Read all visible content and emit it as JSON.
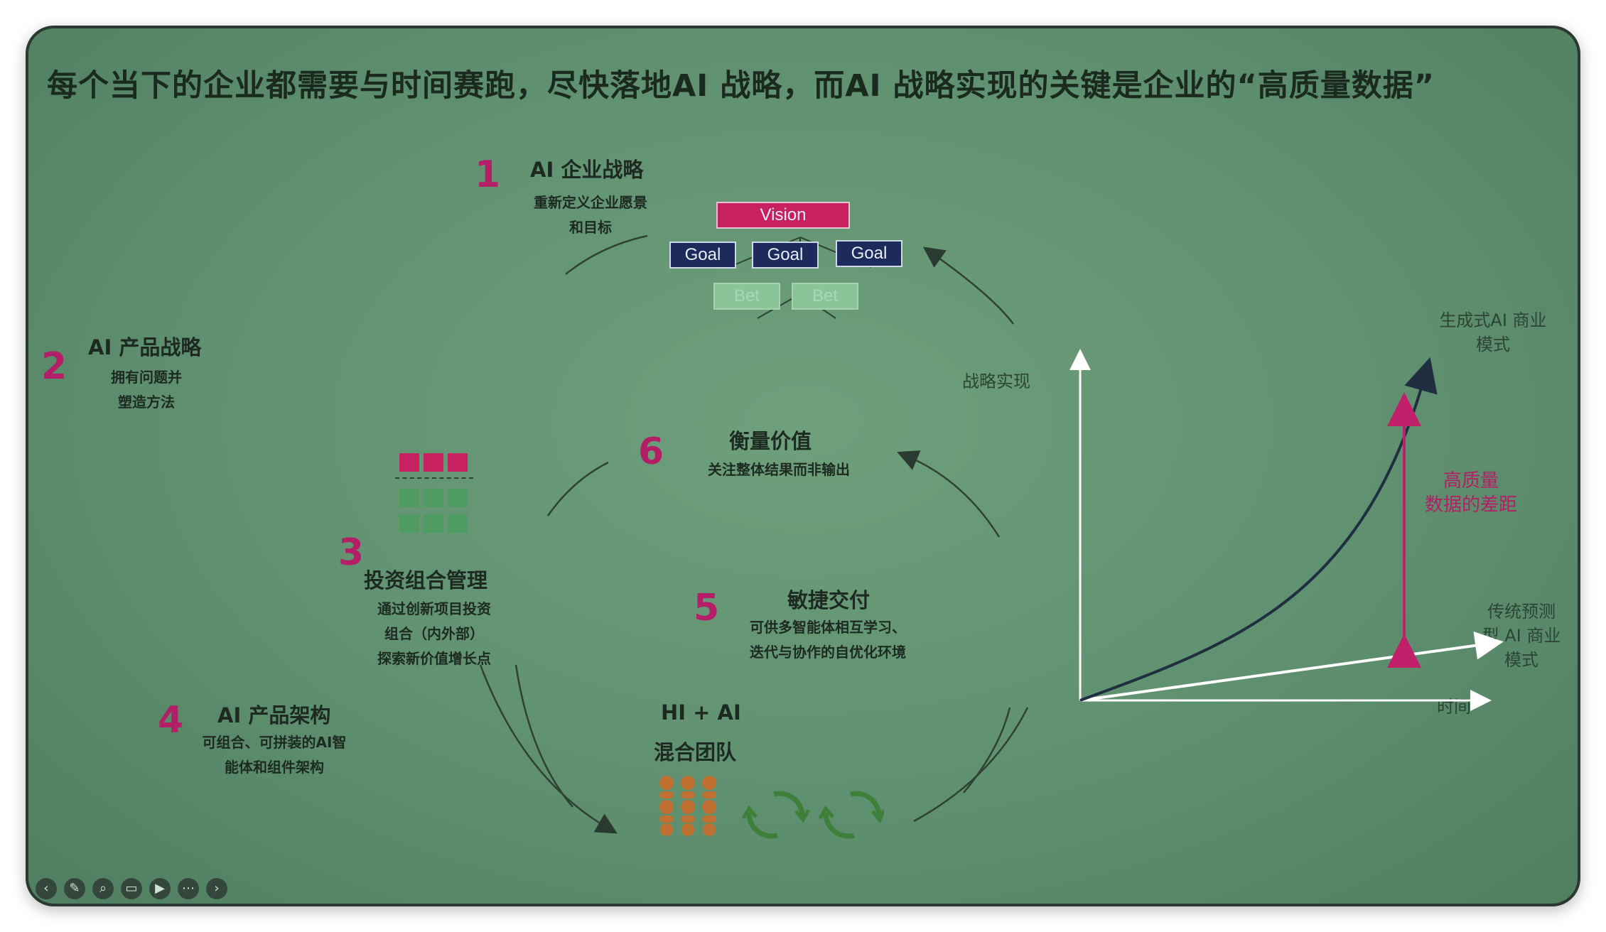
{
  "slide": {
    "title": "每个当下的企业都需要与时间赛跑，尽快落地AI 战略，而AI 战略实现的关键是企业的“高质量数据”"
  },
  "steps": [
    {
      "number": "1",
      "title": "AI 企业战略",
      "desc": [
        "重新定义企业愿景",
        "和目标"
      ]
    },
    {
      "number": "2",
      "title": "AI 产品战略",
      "desc": [
        "拥有问题并",
        "塑造方法"
      ]
    },
    {
      "number": "3",
      "title": "投资组合管理",
      "desc": [
        "通过创新项目投资",
        "组合（内外部）",
        "探索新价值增长点"
      ]
    },
    {
      "number": "4",
      "title": "AI 产品架构",
      "desc": [
        "可组合、可拼装的AI智",
        "能体和组件架构"
      ]
    },
    {
      "number": "5",
      "title": "敏捷交付",
      "desc": [
        "可供多智能体相互学习、",
        "迭代与协作的自优化环境"
      ]
    },
    {
      "number": "6",
      "title": "衡量价值",
      "desc": [
        "关注整体结果而非输出"
      ]
    }
  ],
  "hierarchy": {
    "vision": "Vision",
    "goals": [
      "Goal",
      "Goal",
      "Goal"
    ],
    "bets": [
      "Bet",
      "Bet"
    ]
  },
  "team": {
    "line1": "HI + AI",
    "line2": "混合团队"
  },
  "chart": {
    "ylabel": "战略实现",
    "xlabel": "时间",
    "upper_series": [
      "生成式AI 商业",
      "模式"
    ],
    "lower_series": [
      "传统预测",
      "型 AI 商业",
      "模式"
    ],
    "gap_label": [
      "高质量",
      "数据的差距"
    ],
    "colors": {
      "curve": "#1f2f3f",
      "gap": "#c0206a",
      "axis": "#ffffff"
    }
  },
  "toolbar": [
    "back-icon",
    "pen-icon",
    "search-icon",
    "caption-icon",
    "video-icon",
    "more-icon",
    "forward-icon"
  ]
}
